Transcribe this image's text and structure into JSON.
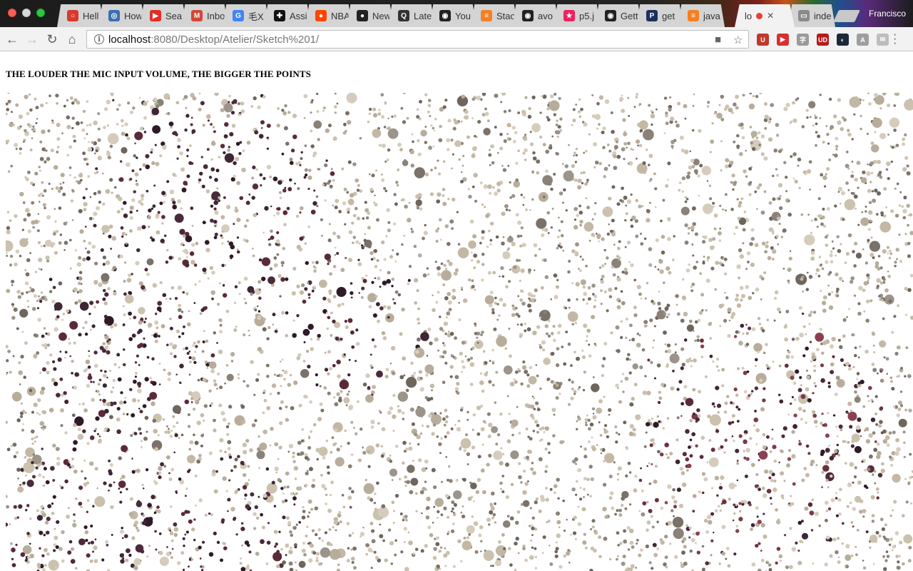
{
  "browser": {
    "tabs": [
      {
        "label": "Hell",
        "icon": "opera-ring-icon",
        "icon_color": "#d93a2b",
        "glyph": "○"
      },
      {
        "label": "How",
        "icon": "globe-icon",
        "icon_color": "#3b6fb0",
        "glyph": "◎"
      },
      {
        "label": "Sea",
        "icon": "youtube-icon",
        "icon_color": "#e52d27",
        "glyph": "▶"
      },
      {
        "label": "Inbo",
        "icon": "gmail-icon",
        "icon_color": "#d44638",
        "glyph": "M"
      },
      {
        "label": "毛X",
        "icon": "google-icon",
        "icon_color": "#4285f4",
        "glyph": "G"
      },
      {
        "label": "Assi",
        "icon": "grid-cross-icon",
        "icon_color": "#111111",
        "glyph": "✚"
      },
      {
        "label": "NBA",
        "icon": "reddit-icon",
        "icon_color": "#ff4500",
        "glyph": "●"
      },
      {
        "label": "New",
        "icon": "dot-circle-icon",
        "icon_color": "#222222",
        "glyph": "●"
      },
      {
        "label": "Late",
        "icon": "q-icon",
        "icon_color": "#333333",
        "glyph": "Q"
      },
      {
        "label": "You",
        "icon": "github-icon",
        "icon_color": "#222222",
        "glyph": "◉"
      },
      {
        "label": "Stac",
        "icon": "stackoverflow-icon",
        "icon_color": "#f48024",
        "glyph": "≡"
      },
      {
        "label": "avo",
        "icon": "github-icon",
        "icon_color": "#222222",
        "glyph": "◉"
      },
      {
        "label": "p5.j",
        "icon": "p5-star-icon",
        "icon_color": "#ed225d",
        "glyph": "★"
      },
      {
        "label": "Gett",
        "icon": "github-icon",
        "icon_color": "#222222",
        "glyph": "◉"
      },
      {
        "label": "get",
        "icon": "p-icon",
        "icon_color": "#1d2f5e",
        "glyph": "P"
      },
      {
        "label": "java",
        "icon": "stackoverflow-icon",
        "icon_color": "#f48024",
        "glyph": "≡"
      },
      {
        "label": "lo",
        "icon": "recording-dot-icon",
        "icon_color": "#e54136",
        "glyph": "",
        "active": true
      },
      {
        "label": "inde",
        "icon": "page-icon",
        "icon_color": "#8a8a8a",
        "glyph": "▭"
      }
    ],
    "close_glyph": "✕",
    "profile_name": "Francisco",
    "address": {
      "host": "localhost",
      "path": ":8080/Desktop/Atelier/Sketch%201/"
    },
    "extensions": [
      {
        "name": "ublock-icon",
        "color": "#c0392b",
        "glyph": "U"
      },
      {
        "name": "play-ext-icon",
        "color": "#d63031",
        "glyph": "▶"
      },
      {
        "name": "kanji-ext-icon",
        "color": "#9a9a9a",
        "glyph": "字"
      },
      {
        "name": "ud-ext-icon",
        "color": "#b71c1c",
        "glyph": "UD"
      },
      {
        "name": "steam-ext-icon",
        "color": "#1b2838",
        "glyph": "◐"
      },
      {
        "name": "translate-ext-icon",
        "color": "#9e9e9e",
        "glyph": "A"
      },
      {
        "name": "mail-ext-icon",
        "color": "#bdbdbd",
        "glyph": "✉"
      }
    ]
  },
  "page": {
    "heading": "THE LOUDER THE MIC INPUT VOLUME, THE BIGGER THE POINTS"
  },
  "sketch": {
    "palette": {
      "light": [
        "#d6ccbc",
        "#cbc1ad",
        "#c4b8a4",
        "#b8ad9a"
      ],
      "mid": [
        "#9c948a",
        "#8a8177",
        "#7a7168",
        "#6e655c"
      ],
      "dark": [
        "#3e2634",
        "#2f1a28",
        "#4a2a3a",
        "#5a2a3a"
      ],
      "accent": [
        "#7a3a4a",
        "#8a4050",
        "#6a3040"
      ]
    }
  }
}
